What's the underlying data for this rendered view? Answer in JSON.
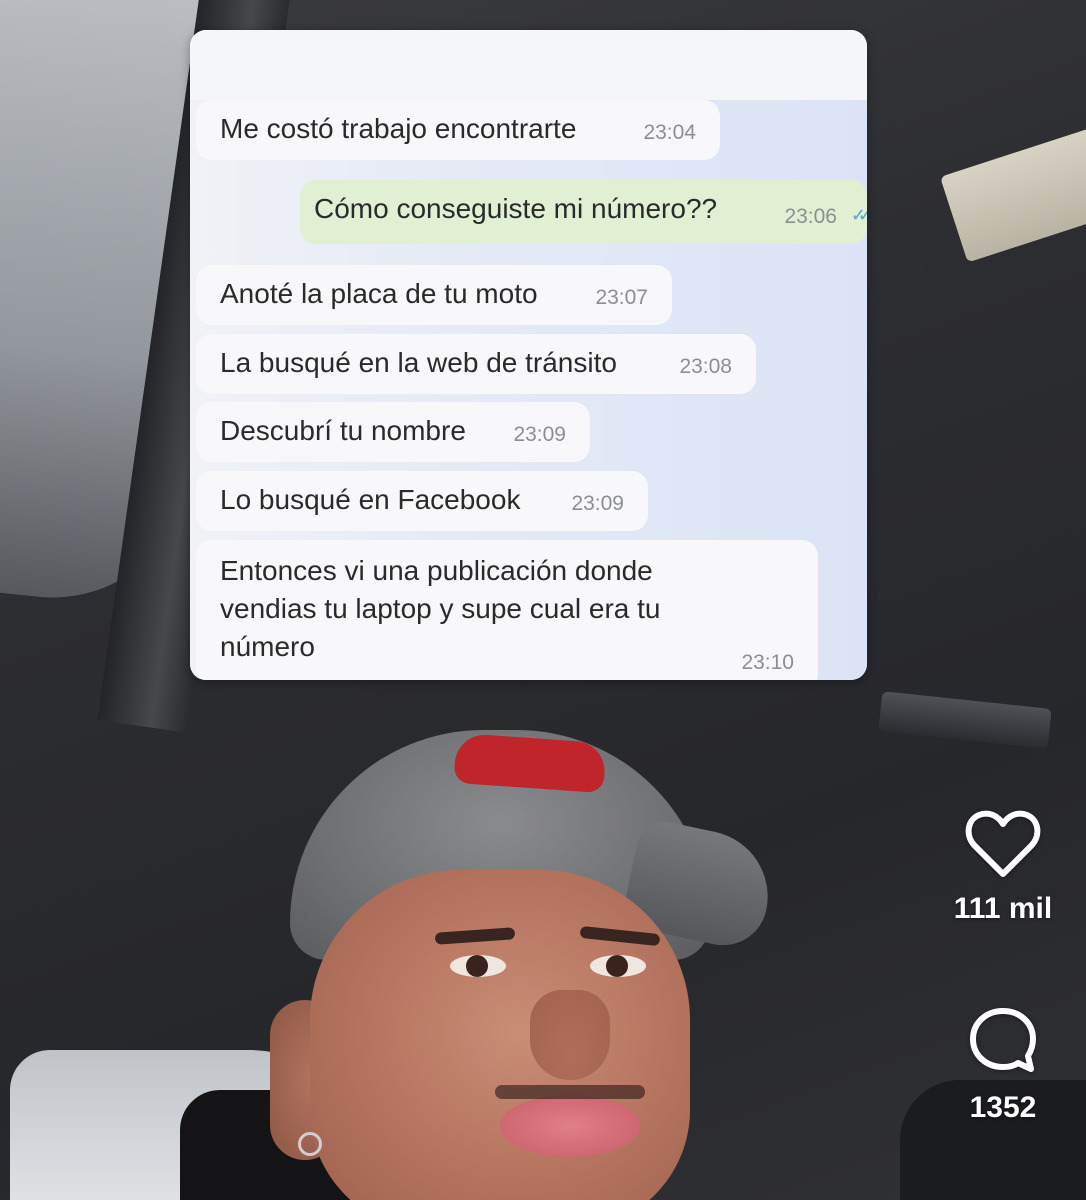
{
  "chat": {
    "messages": [
      {
        "text": "Me costó trabajo encontrarte",
        "time": "23:04",
        "direction": "incoming"
      },
      {
        "text": "Cómo conseguiste mi número??",
        "time": "23:06",
        "direction": "outgoing",
        "status": "read"
      },
      {
        "text": "Anoté la placa de tu moto",
        "time": "23:07",
        "direction": "incoming"
      },
      {
        "text": "La busqué en la web de tránsito",
        "time": "23:08",
        "direction": "incoming"
      },
      {
        "text": "Descubrí tu nombre",
        "time": "23:09",
        "direction": "incoming"
      },
      {
        "text": "Lo busqué en Facebook",
        "time": "23:09",
        "direction": "incoming"
      },
      {
        "text": "Entonces vi una publicación donde vendias tu laptop y supe cual era tu número",
        "time": "23:10",
        "direction": "incoming"
      }
    ]
  },
  "actions": {
    "like": {
      "icon": "heart-icon",
      "count": "111 mil"
    },
    "comment": {
      "icon": "comment-bubble-icon",
      "count": "1352"
    }
  },
  "colors": {
    "incoming_bubble": "#f8f8fa",
    "outgoing_bubble": "#e1f0d2",
    "read_check": "#53a6d6",
    "chat_background": "#dbe4f6"
  }
}
